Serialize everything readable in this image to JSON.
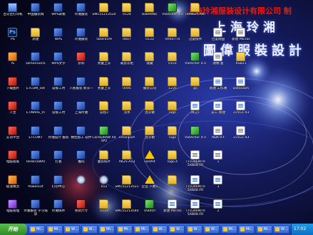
{
  "wallpaper": {
    "company_title": "上海玲湘服装设计有限公司 制",
    "calligraphy_line1": "上海玲湘",
    "calligraphy_line2": "圖偉服裝設計"
  },
  "desktop_icons": [
    {
      "label": "百分百打印机",
      "icon": "pc-icon"
    },
    {
      "label": "中国服装网",
      "icon": "app-icon"
    },
    {
      "label": "WPS表格",
      "icon": "app-icon"
    },
    {
      "label": "玲湘服装",
      "icon": "app-icon"
    },
    {
      "label": "SM151213520",
      "icon": "folder-icon"
    },
    {
      "label": "0124",
      "icon": "folder-icon"
    },
    {
      "label": "bab9dfbc",
      "icon": "folder-icon"
    },
    {
      "label": "VStitcher 4.0",
      "icon": "green-icon"
    },
    {
      "label": "TRANSPLANT",
      "icon": "folder-icon"
    },
    {
      "label": "PS",
      "icon": "ps-icon"
    },
    {
      "label": "新建",
      "icon": "folder-icon"
    },
    {
      "label": "WPS",
      "icon": "app-icon"
    },
    {
      "label": "玲湘服装",
      "icon": "app-icon"
    },
    {
      "label": "5b9cd1f9",
      "icon": "folder-icon"
    },
    {
      "label": "0607",
      "icon": "folder-icon"
    },
    {
      "label": "0133",
      "icon": "folder-icon"
    },
    {
      "label": "ntf40770",
      "icon": "folder-icon"
    },
    {
      "label": "迅雷快传",
      "icon": "folder-icon"
    },
    {
      "label": "百度网盘",
      "icon": "doc-icon"
    },
    {
      "label": "新建 Micros",
      "icon": "doc-icon"
    },
    {
      "label": "Ai",
      "icon": "orange-icon"
    },
    {
      "label": "Dimension5",
      "icon": "app-icon"
    },
    {
      "label": "WPS文字",
      "icon": "app-icon"
    },
    {
      "label": "挤料",
      "icon": "red-icon"
    },
    {
      "label": "男童上衣",
      "icon": "folder-icon"
    },
    {
      "label": "裁剪衣柜",
      "icon": "folder-icon"
    },
    {
      "label": "收藏",
      "icon": "folder-icon"
    },
    {
      "label": "0101",
      "icon": "folder-icon"
    },
    {
      "label": "VStitcher 4.0",
      "icon": "green-icon"
    },
    {
      "label": "收纳 夏",
      "icon": "doc-icon"
    },
    {
      "label": "XSB21",
      "icon": "folder-icon"
    },
    {
      "label": "下载图片",
      "icon": "red-icon"
    },
    {
      "label": "ETCOM_net",
      "icon": "app-icon"
    },
    {
      "label": "常规工时",
      "icon": "app-icon"
    },
    {
      "label": "人民服装 新衣一",
      "icon": "app-icon"
    },
    {
      "label": "男童上衣",
      "icon": "folder-icon"
    },
    {
      "label": "0095",
      "icon": "folder-icon"
    },
    {
      "label": "服装公司",
      "icon": "folder-icon"
    },
    {
      "label": "1235",
      "icon": "folder-icon"
    },
    {
      "label": "g5",
      "icon": "folder-icon"
    },
    {
      "label": "新建 工作簿",
      "icon": "doc-icon"
    },
    {
      "label": "DataSlam",
      "icon": "doc-icon"
    },
    {
      "label": "人生",
      "icon": "red-icon"
    },
    {
      "label": "ETWARE_m",
      "icon": "app-icon"
    },
    {
      "label": "常规工时",
      "icon": "app-icon"
    },
    {
      "label": "上海玲湘",
      "icon": "app-icon"
    },
    {
      "label": "前程2",
      "icon": "folder-icon"
    },
    {
      "label": "流水",
      "icon": "folder-icon"
    },
    {
      "label": "连衣裙",
      "icon": "folder-icon"
    },
    {
      "label": "logo",
      "icon": "folder-icon"
    },
    {
      "label": "目己1",
      "icon": "doc-icon"
    },
    {
      "label": "员工 新建",
      "icon": "doc-icon"
    },
    {
      "label": "115G1-43",
      "icon": "doc-icon"
    },
    {
      "label": "实训平台",
      "icon": "red-icon"
    },
    {
      "label": "ETCOM7",
      "icon": "app-icon"
    },
    {
      "label": "玲湘设计 服装",
      "icon": "app-icon"
    },
    {
      "label": "数控加工 软件",
      "icon": "app-icon"
    },
    {
      "label": "CorelDRAW X4 SP2",
      "icon": "green-icon"
    },
    {
      "label": "emanport",
      "icon": "folder-icon"
    },
    {
      "label": "连衣裙",
      "icon": "folder-icon"
    },
    {
      "label": "logo",
      "icon": "folder-icon"
    },
    {
      "label": "VStitcher 4.0",
      "icon": "green-icon"
    },
    {
      "label": "NDK-R-t",
      "icon": "doc-icon"
    },
    {
      "label": "115G1-43",
      "icon": "doc-icon"
    },
    {
      "label": "电脑管家",
      "icon": "red-icon"
    },
    {
      "label": "RedarisWAI",
      "icon": "app-icon"
    },
    {
      "label": "打板",
      "icon": "app-icon"
    },
    {
      "label": "推码",
      "icon": "app-icon"
    },
    {
      "label": "童装照片",
      "icon": "folder-icon"
    },
    {
      "label": "AK25-A13",
      "icon": "folder-icon"
    },
    {
      "label": "FastAit",
      "icon": "warn-icon"
    },
    {
      "label": "logo.4",
      "icon": "folder-icon"
    },
    {
      "label": "TT0346M70 5XB08 FR",
      "icon": "doc-icon"
    },
    {
      "label": "1",
      "icon": "doc-icon"
    },
    {
      "label": "极速精灵",
      "icon": "orange-icon"
    },
    {
      "label": "PowerExt",
      "icon": "app-icon"
    },
    {
      "label": "打印中心",
      "icon": "app-icon"
    },
    {
      "label": "",
      "icon": "cd-icon"
    },
    {
      "label": "012",
      "icon": "cd-icon"
    },
    {
      "label": "SM151213521",
      "icon": "folder-icon"
    },
    {
      "label": "企业 人数1",
      "icon": "warn-icon"
    },
    {
      "label": "",
      "icon": "folder-icon"
    },
    {
      "label": "TT0346M70 5XB08 FR",
      "icon": "doc-icon"
    },
    {
      "label": "3",
      "icon": "doc-icon"
    },
    {
      "label": "电脑管理",
      "icon": "purple-icon"
    },
    {
      "label": "玲湘服装 学习培训",
      "icon": "app-icon"
    },
    {
      "label": "玲湘快传",
      "icon": "app-icon"
    },
    {
      "label": "男装尺寸",
      "icon": "red-icon"
    },
    {
      "label": "0123",
      "icon": "folder-icon"
    },
    {
      "label": "SM151213540",
      "icon": "folder-icon"
    },
    {
      "label": "VStitch",
      "icon": "green-icon"
    },
    {
      "label": "新建 Micros",
      "icon": "doc-icon"
    },
    {
      "label": "TT0346M70 5XB08 FR",
      "icon": "doc-icon"
    },
    {
      "label": "2",
      "icon": "doc-icon"
    }
  ],
  "taskbar": {
    "start_label": "开始",
    "buttons": [
      {
        "label": "Mi…"
      },
      {
        "label": "Mi…"
      },
      {
        "label": "W…"
      },
      {
        "label": "W…"
      },
      {
        "label": "Mi…"
      },
      {
        "label": "Mi…"
      },
      {
        "label": "Mi…"
      },
      {
        "label": "W…"
      },
      {
        "label": "W…"
      },
      {
        "label": "W…"
      },
      {
        "label": "W…"
      },
      {
        "label": "Mi…"
      },
      {
        "label": "Mi…"
      },
      {
        "label": "Mi…"
      },
      {
        "label": "W…"
      }
    ],
    "clock": "17:02"
  }
}
